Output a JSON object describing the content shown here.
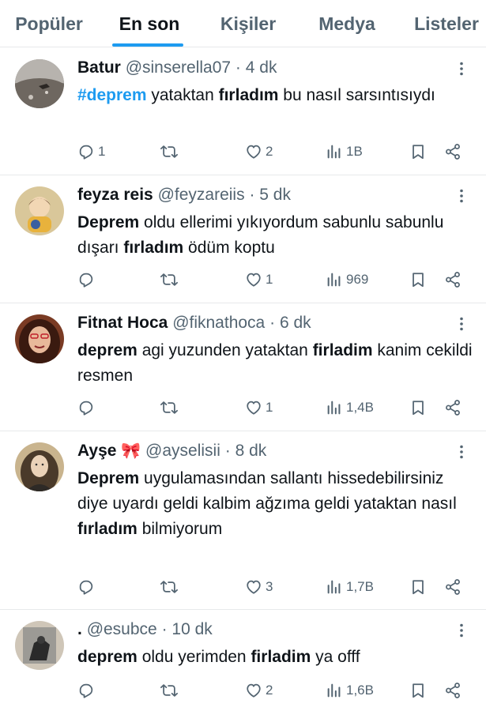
{
  "tabs": [
    {
      "label": "Popüler",
      "active": false
    },
    {
      "label": "En son",
      "active": true
    },
    {
      "label": "Kişiler",
      "active": false
    },
    {
      "label": "Medya",
      "active": false
    },
    {
      "label": "Listeler",
      "active": false
    }
  ],
  "colors": {
    "accent": "#1d9bf0",
    "secondary_text": "#536471",
    "primary_text": "#0f1419"
  },
  "tweets": [
    {
      "name": "Batur",
      "handle": "@sinserella07",
      "time": "4 dk",
      "text": {
        "hashtag": "#deprem",
        "t1": " yataktan ",
        "b1": "fırladım",
        "t2": " bu nasıl sarsıntısıydı"
      },
      "replies": "1",
      "retweets": "",
      "likes": "2",
      "views": "1B"
    },
    {
      "name": "feyza reis",
      "handle": "@feyzareiis",
      "time": "5 dk",
      "text": {
        "b0": "Deprem",
        "t1": " oldu ellerimi yıkıyordum sabunlu sabunlu dışarı ",
        "b1": "fırladım",
        "t2": " ödüm koptu"
      },
      "replies": "",
      "retweets": "",
      "likes": "1",
      "views": "969"
    },
    {
      "name": "Fitnat Hoca",
      "handle": "@fiknathoca",
      "time": "6 dk",
      "text": {
        "b0": "deprem",
        "t1": " agi yuzunden yataktan ",
        "b1": "firladim",
        "t2": " kanim cekildi resmen"
      },
      "replies": "",
      "retweets": "",
      "likes": "1",
      "views": "1,4B"
    },
    {
      "name": "Ayşe",
      "name_emoji": "🎀",
      "handle": "@ayselisii",
      "time": "8 dk",
      "text": {
        "b0": "Deprem",
        "t1": " uygulamasından sallantı hissedebilirsiniz diye uyardı geldi kalbim ağzıma geldi yataktan nasıl ",
        "b1": "fırladım",
        "t2": " bilmiyorum"
      },
      "replies": "",
      "retweets": "",
      "likes": "3",
      "views": "1,7B"
    },
    {
      "name": ".",
      "handle": "@esubce",
      "time": "10 dk",
      "text": {
        "b0": "deprem",
        "t1": " oldu yerimden ",
        "b1": "firladim",
        "t2": " ya offf"
      },
      "replies": "",
      "retweets": "",
      "likes": "2",
      "views": "1,6B"
    }
  ],
  "icons": {
    "reply": "reply-icon",
    "retweet": "retweet-icon",
    "like": "heart-icon",
    "views": "views-icon",
    "bookmark": "bookmark-icon",
    "share": "share-icon",
    "more": "more-icon"
  }
}
